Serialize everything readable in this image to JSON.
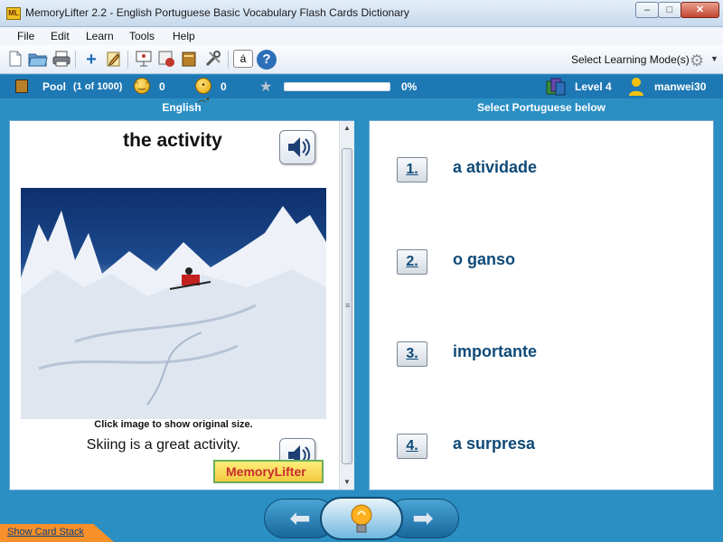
{
  "window": {
    "title": "MemoryLifter 2.2 - English Portuguese Basic Vocabulary Flash Cards Dictionary",
    "app_icon_text": "ML"
  },
  "menu": [
    "File",
    "Edit",
    "Learn",
    "Tools",
    "Help"
  ],
  "toolbar": {
    "icons": [
      "new-icon",
      "open-icon",
      "print-icon",
      "add-icon",
      "edit-icon",
      "slideshow-icon",
      "statistics-icon",
      "dictionary-icon",
      "settings-tools-icon",
      "special-characters-icon",
      "help-icon"
    ],
    "special_char_label": "á",
    "help_label": "?",
    "mode_label": "Select Learning Mode(s)"
  },
  "status": {
    "pool_label": "Pool",
    "pool_count": "(1 of 1000)",
    "correct_count": "0",
    "wrong_count": "0",
    "progress_percent": 0,
    "progress_text": "0%",
    "level": "Level 4",
    "user": "manwei30"
  },
  "left": {
    "header": "English",
    "word": "the activity",
    "caption": "Click image to show original size.",
    "example": "Skiing is a great activity.",
    "logo_text": "MemoryLifter"
  },
  "right": {
    "header": "Select Portuguese below",
    "answers": [
      {
        "num": "1.",
        "text": "a atividade"
      },
      {
        "num": "2.",
        "text": "o ganso"
      },
      {
        "num": "3.",
        "text": "importante"
      },
      {
        "num": "4.",
        "text": "a surpresa"
      }
    ]
  },
  "nav": {
    "prev_icon": "left-arrow-icon",
    "hint_icon": "lightbulb-icon",
    "next_icon": "right-arrow-icon"
  },
  "footer": {
    "show_card_stack": "Show Card Stack"
  },
  "colors": {
    "background": "#2b8fc4",
    "status_bar": "#1e78b4",
    "answer_text": "#0f4a78",
    "show_stack": "#f79028"
  }
}
